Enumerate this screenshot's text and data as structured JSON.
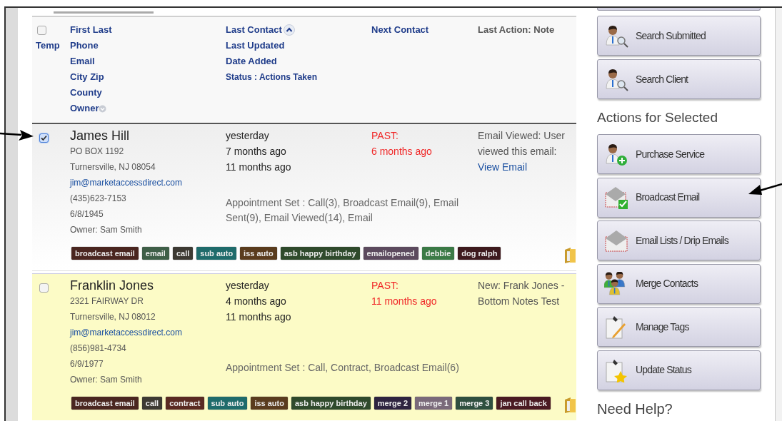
{
  "header": {
    "checked": false,
    "temp": "Temp",
    "contact_fields": [
      {
        "label": "First Last",
        "menu": false
      },
      {
        "label": "Phone",
        "menu": false
      },
      {
        "label": "Email",
        "menu": false
      },
      {
        "label": "City Zip",
        "menu": false
      },
      {
        "label": "County",
        "menu": false
      },
      {
        "label": "Owner",
        "menu": true
      }
    ],
    "date_fields": [
      {
        "label": "Last Contact",
        "sorted": true
      },
      {
        "label": "Last Updated",
        "sorted": false
      },
      {
        "label": "Date Added",
        "sorted": false
      },
      {
        "label": "Status : Actions Taken",
        "sorted": false
      }
    ],
    "next_contact": "Next Contact",
    "last_action": "Last Action: Note"
  },
  "rows": [
    {
      "selected": true,
      "highlighted": false,
      "name": "James Hill",
      "address": "PO BOX 1192",
      "city": "Turnersville, NJ 08054",
      "email": "jim@marketaccessdirect.com",
      "phone": "(435)623-7153",
      "birthdate": "6/8/1945",
      "owner": "Owner: Sam Smith",
      "dates": [
        "yesterday",
        "7 months ago",
        "11 months ago"
      ],
      "next_status": "PAST:",
      "next_when": "6 months ago",
      "note": "Email Viewed: User viewed this email:",
      "note_link": "View Email",
      "actions": "Appointment Set : Call(3), Broadcast Email(9), Email Sent(9), Email Viewed(14), Email",
      "tags": [
        {
          "label": "broadcast email",
          "color": "#4a2620"
        },
        {
          "label": "email",
          "color": "#3f5f48"
        },
        {
          "label": "call",
          "color": "#3d3a33"
        },
        {
          "label": "sub auto",
          "color": "#1f6b6b"
        },
        {
          "label": "iss auto",
          "color": "#5a3c1e"
        },
        {
          "label": "asb happy birthday",
          "color": "#2f4a2c"
        },
        {
          "label": "emailopened",
          "color": "#5c4a5e"
        },
        {
          "label": "debbie",
          "color": "#3b7a46"
        },
        {
          "label": "dog ralph",
          "color": "#3e1a1e"
        }
      ]
    },
    {
      "selected": false,
      "highlighted": true,
      "name": "Franklin Jones",
      "address": "2321 FAIRWAY DR",
      "city": "Turnersville, NJ 08012",
      "email": "jim@marketaccessdirect.com",
      "phone": "(856)981-4734",
      "birthdate": "6/9/1977",
      "owner": "Owner: Sam Smith",
      "dates": [
        "yesterday",
        "4 months ago",
        "11 months ago"
      ],
      "next_status": "PAST:",
      "next_when": "11 months ago",
      "note": "New: Frank Jones - Bottom Notes Test",
      "actions": "Appointment Set : Call, Contract, Broadcast Email(6)",
      "tags": [
        {
          "label": "broadcast email",
          "color": "#4a2620"
        },
        {
          "label": "call",
          "color": "#3d3a33"
        },
        {
          "label": "contract",
          "color": "#5a2a22"
        },
        {
          "label": "sub auto",
          "color": "#1f6b6b"
        },
        {
          "label": "iss auto",
          "color": "#5a3c1e"
        },
        {
          "label": "asb happy birthday",
          "color": "#2f4a2c"
        },
        {
          "label": "merge 2",
          "color": "#2e2440"
        },
        {
          "label": "merge 1",
          "color": "#7a6a7a"
        },
        {
          "label": "merge 3",
          "color": "#2f4f3f"
        },
        {
          "label": "jan call back",
          "color": "#4a1a22"
        }
      ]
    }
  ],
  "sidebar": {
    "search_buttons": [
      {
        "label": "Search Submitted",
        "kind": "person-search"
      },
      {
        "label": "Search Client",
        "kind": "person-search"
      }
    ],
    "actions_heading": "Actions for Selected",
    "actions": [
      {
        "label": "Purchase Service",
        "kind": "person-add"
      },
      {
        "label": "Broadcast Email",
        "kind": "envelope-check"
      },
      {
        "label": "Email Lists / Drip Emails",
        "kind": "envelope"
      },
      {
        "label": "Merge Contacts",
        "kind": "people"
      },
      {
        "label": "Manage Tags",
        "kind": "note-pencil"
      },
      {
        "label": "Update Status",
        "kind": "note-star"
      }
    ],
    "help_heading": "Need Help?"
  }
}
